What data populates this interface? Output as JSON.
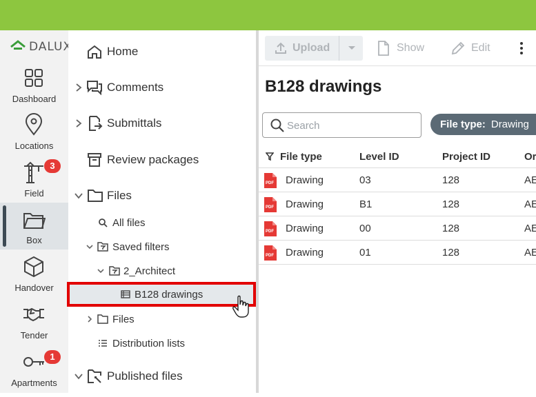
{
  "brand": {
    "name": "DALUX",
    "accent": "#8dc63f"
  },
  "rail": {
    "items": [
      {
        "label": "Dashboard",
        "icon": "dashboard-icon"
      },
      {
        "label": "Locations",
        "icon": "location-pin-icon"
      },
      {
        "label": "Field",
        "icon": "crane-icon",
        "badge": "3"
      },
      {
        "label": "Box",
        "icon": "folder-open-icon",
        "active": true
      },
      {
        "label": "Handover",
        "icon": "box-icon"
      },
      {
        "label": "Tender",
        "icon": "handshake-icon"
      },
      {
        "label": "Apartments",
        "icon": "key-icon",
        "badge": "1"
      }
    ]
  },
  "nav": {
    "home": "Home",
    "comments": "Comments",
    "submittals": "Submittals",
    "review_packages": "Review packages",
    "files": "Files",
    "all_files": "All files",
    "saved_filters": "Saved filters",
    "architect": "2_Architect",
    "b128": "B128 drawings",
    "files_sub": "Files",
    "distribution_lists": "Distribution lists",
    "published_files": "Published files"
  },
  "toolbar": {
    "upload": "Upload",
    "show": "Show",
    "edit": "Edit"
  },
  "main": {
    "title": "B128 drawings",
    "search_placeholder": "Search",
    "chip_key": "File type:",
    "chip_value": "Drawing"
  },
  "table": {
    "headers": {
      "file_type": "File type",
      "level": "Level ID",
      "project": "Project ID",
      "other": "Or"
    },
    "rows": [
      {
        "file_type": "Drawing",
        "level": "03",
        "project": "128",
        "other": "AE"
      },
      {
        "file_type": "Drawing",
        "level": "B1",
        "project": "128",
        "other": "AE"
      },
      {
        "file_type": "Drawing",
        "level": "00",
        "project": "128",
        "other": "AE"
      },
      {
        "file_type": "Drawing",
        "level": "01",
        "project": "128",
        "other": "AE"
      }
    ]
  }
}
